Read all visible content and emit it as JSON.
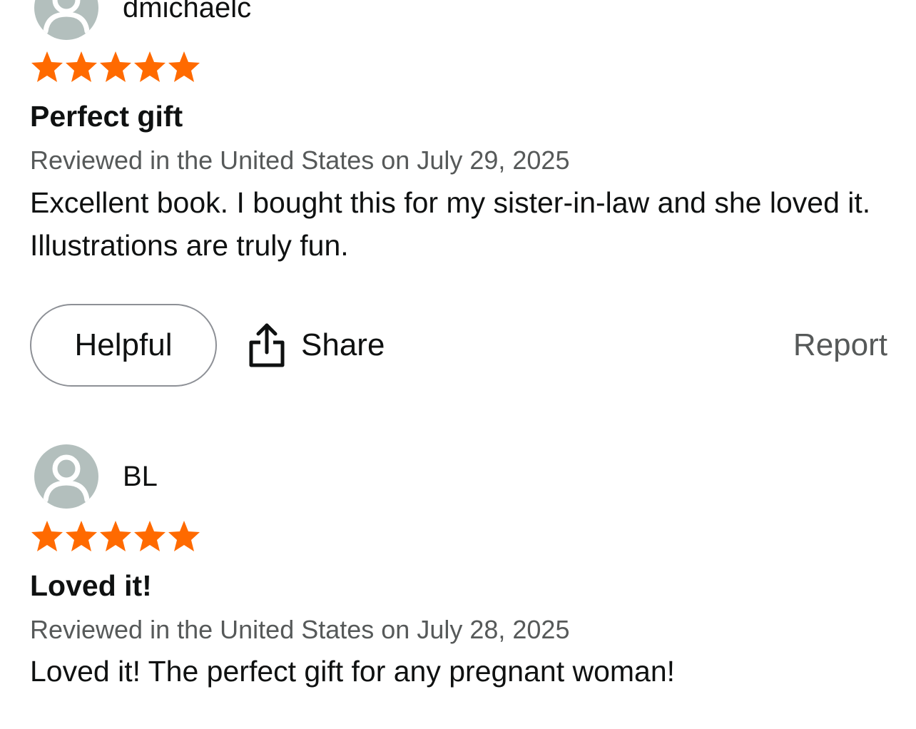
{
  "colors": {
    "star": "#ff6a00",
    "avatar_bg": "#b3bfbd",
    "meta_text": "#565959",
    "primary_text": "#0f1111"
  },
  "reviews": [
    {
      "reviewer": "dmichaelc",
      "rating": 5,
      "rating_max": 5,
      "title": "Perfect gift",
      "meta": "Reviewed in the United States on July 29, 2025",
      "body": "Excellent book. I bought this for my sister-in-law and she loved it. Illustrations are truly fun.",
      "actions": {
        "helpful_label": "Helpful",
        "share_label": "Share",
        "report_label": "Report"
      }
    },
    {
      "reviewer": "BL",
      "rating": 5,
      "rating_max": 5,
      "title": "Loved it!",
      "meta": "Reviewed in the United States on July 28, 2025",
      "body": "Loved it! The perfect gift for any pregnant woman!"
    }
  ]
}
